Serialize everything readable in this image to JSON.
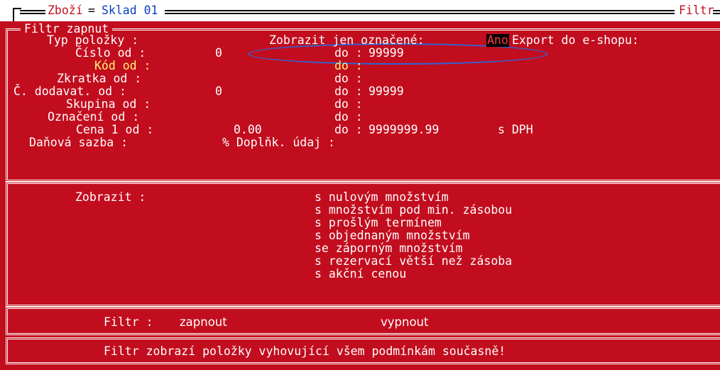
{
  "title_bar": {
    "app": "Zboží",
    "eq": "=",
    "warehouse": "Sklad 01",
    "right": "Filtr"
  },
  "filter_panel": {
    "title": "Filtr zapnut",
    "fields": [
      {
        "label": "Typ položky :",
        "from": "",
        "to_label": "",
        "to": ""
      },
      {
        "label": "Číslo od :",
        "from": "0",
        "to_label": "do :",
        "to": "99999"
      },
      {
        "label": "Kód od :",
        "from": "",
        "to_label": "do :",
        "to": ""
      },
      {
        "label": "Zkratka od :",
        "from": "",
        "to_label": "do :",
        "to": ""
      },
      {
        "label": "Č. dodavat. od :",
        "from": "0",
        "to_label": "do :",
        "to": "99999"
      },
      {
        "label": "Skupina od :",
        "from": "",
        "to_label": "do :",
        "to": ""
      },
      {
        "label": "Označení od :",
        "from": "",
        "to_label": "do :",
        "to": ""
      },
      {
        "label": "Cena 1 od :",
        "from": "0.00",
        "to_label": "do :",
        "to": "9999999.99"
      },
      {
        "label": "Daňová sazba :",
        "from": "% Doplňk. údaj :",
        "to_label": "",
        "to": ""
      }
    ],
    "show_marked_label": "Zobrazit jen označené:",
    "show_marked_value": "Ano",
    "export_label": "Export do e-shopu:",
    "price_suffix": "s DPH"
  },
  "show_panel": {
    "label": "Zobrazit :",
    "options": [
      "s nulovým množstvím",
      "s množstvím pod min. zásobou",
      "s prošlým termínem",
      "s objednaným množstvím",
      "se záporným množstvím",
      "s rezervací větší než zásoba",
      "s akční cenou"
    ]
  },
  "toggle_panel": {
    "label": "Filtr :",
    "on": "zapnout",
    "off": "vypnout"
  },
  "note": "Filtr zobrazí položky vyhovující všem podmínkám současně!",
  "colors": {
    "background": "#c20d1e",
    "text": "#ffffff",
    "highlight": "#fff373",
    "annotation": "#2f64d8"
  }
}
